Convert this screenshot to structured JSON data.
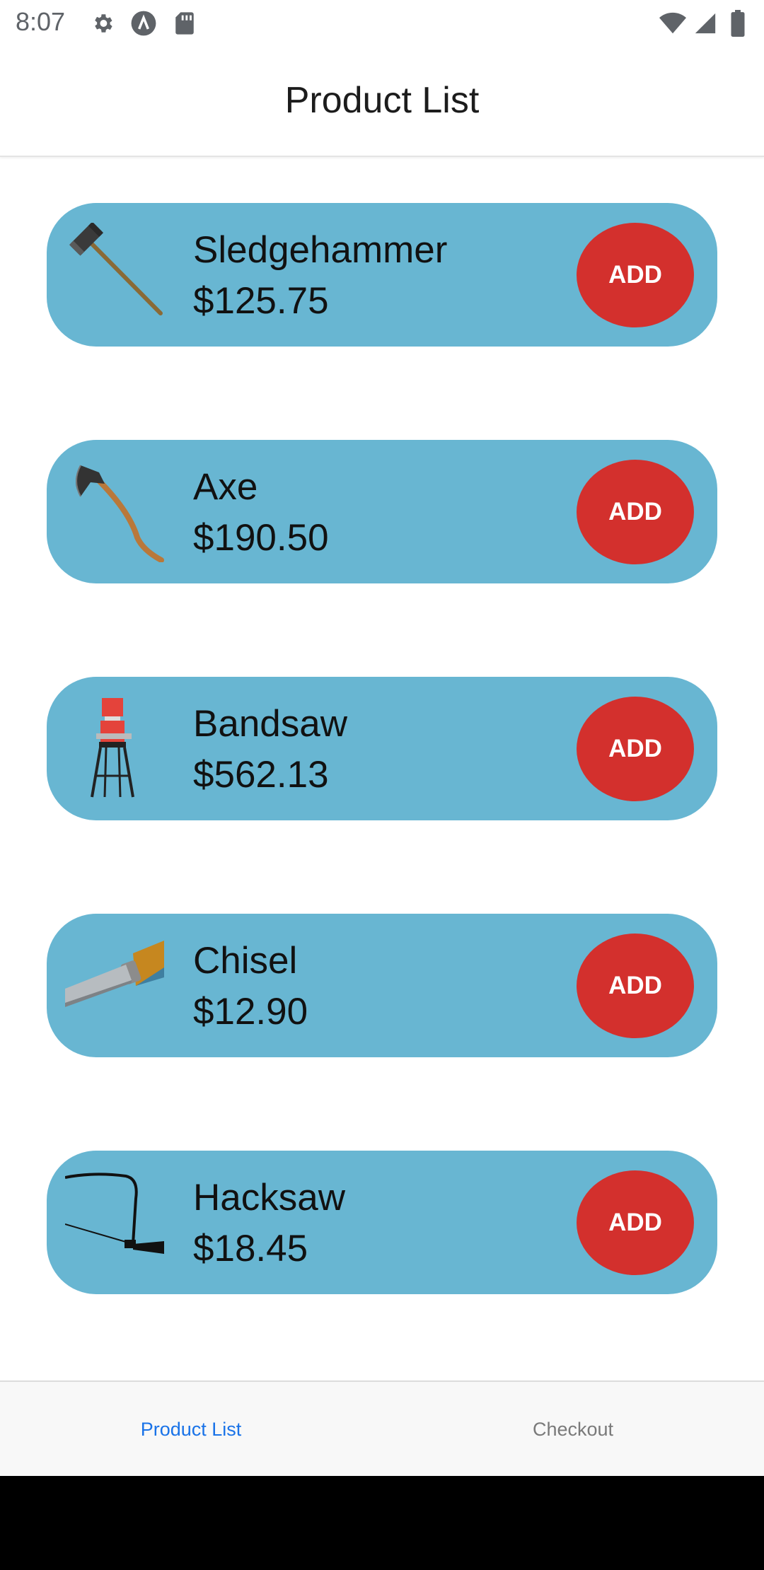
{
  "status_bar": {
    "time": "8:07",
    "left_icons": [
      "gear-icon",
      "app-logo-icon",
      "sd-card-icon"
    ],
    "right_icons": [
      "wifi-icon",
      "signal-icon",
      "battery-icon"
    ]
  },
  "header": {
    "title": "Product List"
  },
  "products": [
    {
      "name": "Sledgehammer",
      "price": "$125.75",
      "image": "sledgehammer-image",
      "button": "ADD"
    },
    {
      "name": "Axe",
      "price": "$190.50",
      "image": "axe-image",
      "button": "ADD"
    },
    {
      "name": "Bandsaw",
      "price": "$562.13",
      "image": "bandsaw-image",
      "button": "ADD"
    },
    {
      "name": "Chisel",
      "price": "$12.90",
      "image": "chisel-image",
      "button": "ADD"
    },
    {
      "name": "Hacksaw",
      "price": "$18.45",
      "image": "hacksaw-image",
      "button": "ADD"
    }
  ],
  "tabs": [
    {
      "label": "Product List",
      "active": true
    },
    {
      "label": "Checkout",
      "active": false
    }
  ],
  "colors": {
    "card_bg": "#68b6d2",
    "add_button": "#d3302d",
    "active_tab": "#1a73e8",
    "inactive_tab": "#7a7a7a"
  }
}
